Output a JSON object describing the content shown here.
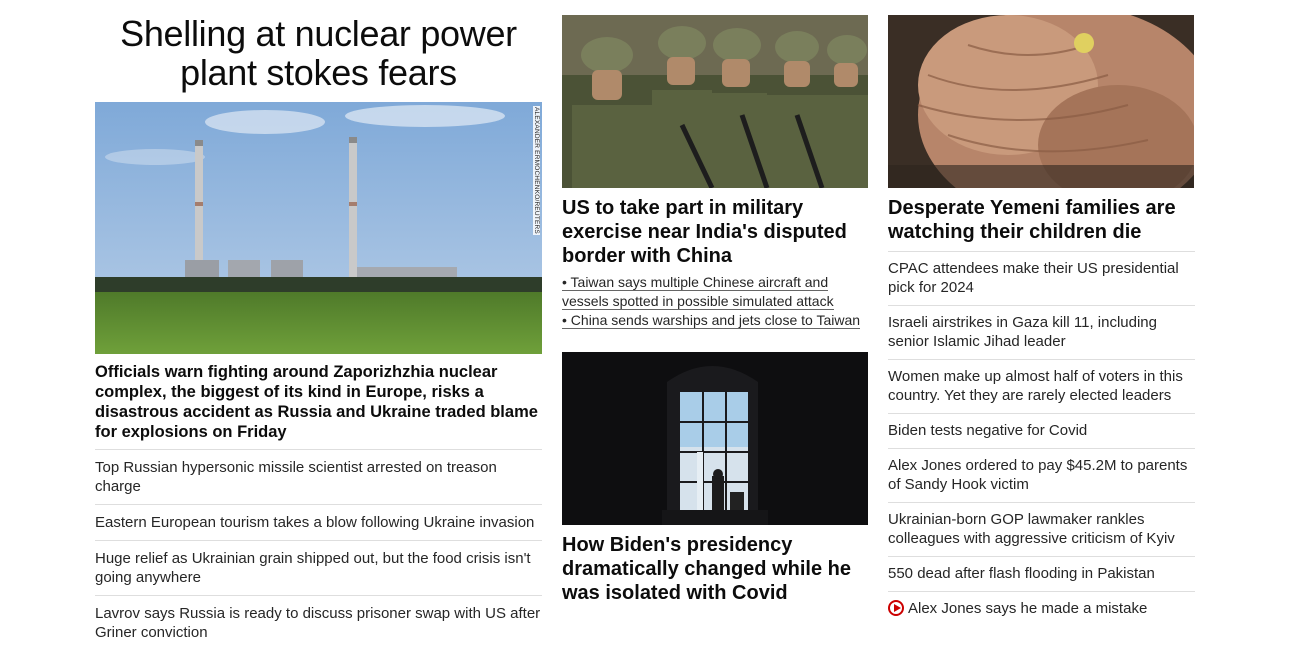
{
  "lead": {
    "headline": "Shelling at nuclear power plant stokes fears",
    "image_credit": "ALEXANDER ERMOCHENKO/REUTERS",
    "description": "Officials warn fighting around Zaporizhzhia nuclear complex, the biggest of its kind in Europe, risks a disastrous accident as Russia and Ukraine traded blame for explosions on Friday",
    "related": [
      "Top Russian hypersonic missile scientist arrested on treason charge",
      "Eastern European tourism takes a blow following Ukraine invasion",
      "Huge relief as Ukrainian grain shipped out, but the food crisis isn't going anywhere",
      "Lavrov says Russia is ready to discuss prisoner swap with US after Griner conviction"
    ]
  },
  "middle": {
    "story1": {
      "headline": "US to take part in military exercise near India's disputed border with China",
      "bullets": [
        "• Taiwan says multiple Chinese aircraft and vessels spotted in possible simulated attack",
        "• China sends warships and jets close to Taiwan"
      ]
    },
    "story2": {
      "headline": "How Biden's presidency dramatically changed while he was isolated with Covid"
    }
  },
  "right": {
    "headline": "Desperate Yemeni families are watching their children die",
    "list": [
      "CPAC attendees make their US presidential pick for 2024",
      "Israeli airstrikes in Gaza kill 11, including senior Islamic Jihad leader",
      "Women make up almost half of voters in this country. Yet they are rarely elected leaders",
      "Biden tests negative for Covid",
      "Alex Jones ordered to pay $45.2M to parents of Sandy Hook victim",
      "Ukrainian-born GOP lawmaker rankles colleagues with aggressive criticism of Kyiv",
      "550 dead after flash flooding in Pakistan"
    ],
    "video_item": "Alex Jones says he made a mistake",
    "video_icon": "play-icon"
  }
}
